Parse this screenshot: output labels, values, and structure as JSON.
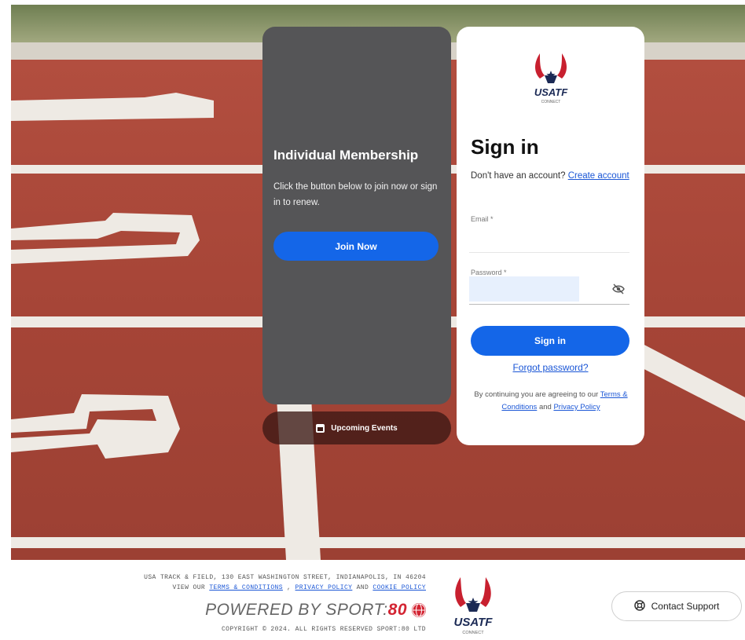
{
  "membership": {
    "title": "Individual Membership",
    "description": "Click the button below to join now or sign in to renew.",
    "join_label": "Join Now",
    "events_label": "Upcoming Events"
  },
  "brand": {
    "logo_text": "USATF",
    "logo_subtext": "CONNECT",
    "accent_color": "#1466e8",
    "logo_red": "#c8202f",
    "logo_navy": "#1b2a55"
  },
  "signin": {
    "title": "Sign in",
    "no_account_text": "Don't have an account?",
    "create_account_link": "Create account",
    "email_label": "Email *",
    "email_value": "",
    "password_label": "Password *",
    "password_value": "",
    "password_toggle_icon": "eye-slash-icon",
    "signin_label": "Sign in",
    "forgot_label": "Forgot password?",
    "agree_prefix": "By continuing you are agreeing to our",
    "terms_link": "Terms & Conditions",
    "agree_and": "and",
    "privacy_link": "Privacy Policy"
  },
  "footer": {
    "address_line": "USA TRACK & FIELD, 130 EAST WASHINGTON STREET, INDIANAPOLIS, IN 46204",
    "view_our": "VIEW OUR",
    "terms_link": "TERMS & CONDITIONS",
    "comma": ",",
    "privacy_link": "PRIVACY POLICY",
    "and_text": "AND",
    "cookie_link": "COOKIE POLICY",
    "powered_by": "POWERED BY SPORT:",
    "powered_num": "80",
    "copyright": "COPYRIGHT © 2024. ALL RIGHTS RESERVED SPORT:80 LTD",
    "support_label": "Contact Support"
  }
}
